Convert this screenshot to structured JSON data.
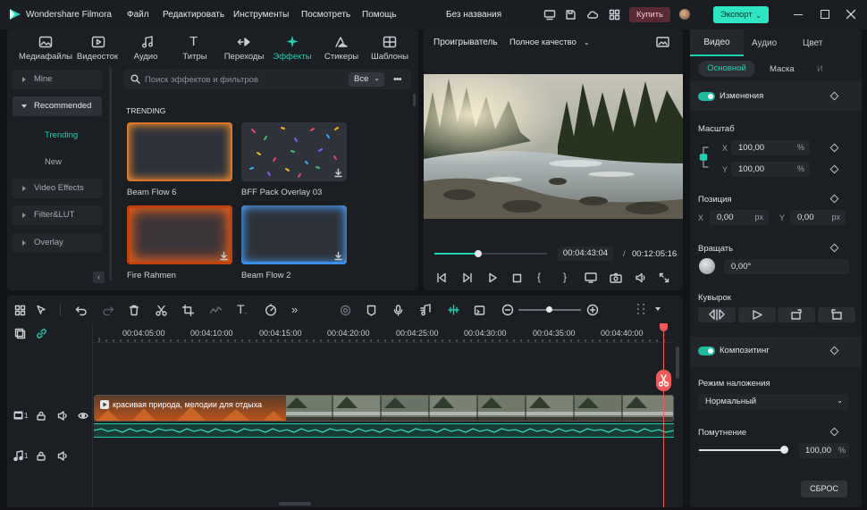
{
  "app": {
    "name": "Wondershare Filmora",
    "project_title": "Без названия"
  },
  "menu": [
    "Файл",
    "Редактировать",
    "Инструменты",
    "Посмотреть",
    "Помощь"
  ],
  "titlebar": {
    "buy_label": "Купить",
    "export_label": "Экспорт"
  },
  "library": {
    "tabs": [
      "Медиафайлы",
      "Видеосток",
      "Аудио",
      "Титры",
      "Переходы",
      "Эффекты",
      "Стикеры",
      "Шаблоны"
    ],
    "active_tab": "Эффекты",
    "sidebar": [
      "Mine",
      "Recommended",
      "Trending",
      "New",
      "Video Effects",
      "Filter&LUT",
      "Overlay"
    ],
    "search_placeholder": "Поиск эффектов и фильтров",
    "filter_value": "Все",
    "section_title": "TRENDING",
    "items": [
      "Beam Flow 6",
      "BFF Pack Overlay 03",
      "Fire Rahmen",
      "Beam Flow 2"
    ]
  },
  "player": {
    "label": "Проигрыватель",
    "quality": "Полное качество",
    "current_time": "00:04:43:04",
    "separator": "/",
    "total_time": "00:12:05:16",
    "progress": 0.39
  },
  "timeline": {
    "ruler": [
      "00:04:05:00",
      "00:04:10:00",
      "00:04:15:00",
      "00:04:20:00",
      "00:04:25:00",
      "00:04:30:00",
      "00:04:35:00",
      "00:04:40:00"
    ],
    "clip_title": "красивая природа, мелодии для отдыха",
    "video_track_num": "1",
    "audio_track_num": "1"
  },
  "properties": {
    "tabs": [
      "Видео",
      "Аудио",
      "Цвет"
    ],
    "subtabs": [
      "Основной",
      "Маска",
      "И"
    ],
    "changes_label": "Изменения",
    "scale_label": "Масштаб",
    "scale_x_label": "X",
    "scale_x": "100,00",
    "scale_y_label": "Y",
    "scale_y": "100,00",
    "percent": "%",
    "position_label": "Позиция",
    "pos_x_label": "X",
    "pos_x": "0,00",
    "pos_y_label": "Y",
    "pos_y": "0,00",
    "px": "px",
    "rotate_label": "Вращать",
    "rotate_value": "0,00°",
    "flip_label": "Кувырок",
    "compositing_label": "Композитинг",
    "blend_label": "Режим наложения",
    "blend_value": "Нормальный",
    "opacity_label": "Помутнение",
    "opacity_value": "100,00",
    "opacity_fraction": 1.0,
    "reset_label": "СБРОС"
  },
  "colors": {
    "accent": "#1fd1b3",
    "playhead": "#f05a5a",
    "buy": "#5a2a34",
    "export": "#2ee6c4"
  }
}
